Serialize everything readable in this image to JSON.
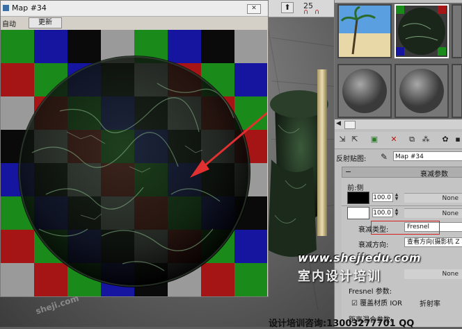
{
  "viewport": {
    "toolbar_numbers": [
      "25"
    ]
  },
  "map_window": {
    "title": "Map #34",
    "close_glyph": "✕",
    "auto_label": "自动",
    "update_label": "更新",
    "checker_colors": [
      [
        "#1a8a1a",
        "#1515a0",
        "#0a0a0a",
        "#9a9a9a",
        "#1a8a1a",
        "#1515a0",
        "#0a0a0a",
        "#9a9a9a"
      ],
      [
        "#a51515",
        "#1a8a1a",
        "#1515a0",
        "#0a0a0a",
        "#9a9a9a",
        "#a51515",
        "#1a8a1a",
        "#1515a0"
      ],
      [
        "#9a9a9a",
        "#a51515",
        "#1a8a1a",
        "#1515a0",
        "#0a0a0a",
        "#9a9a9a",
        "#a51515",
        "#1a8a1a"
      ],
      [
        "#0a0a0a",
        "#9a9a9a",
        "#a51515",
        "#1a8a1a",
        "#1515a0",
        "#0a0a0a",
        "#9a9a9a",
        "#a51515"
      ],
      [
        "#1515a0",
        "#0a0a0a",
        "#9a9a9a",
        "#a51515",
        "#1a8a1a",
        "#1515a0",
        "#0a0a0a",
        "#9a9a9a"
      ],
      [
        "#1a8a1a",
        "#1515a0",
        "#0a0a0a",
        "#9a9a9a",
        "#a51515",
        "#1a8a1a",
        "#1515a0",
        "#0a0a0a"
      ],
      [
        "#a51515",
        "#1a8a1a",
        "#1515a0",
        "#0a0a0a",
        "#9a9a9a",
        "#a51515",
        "#1a8a1a",
        "#1515a0"
      ],
      [
        "#9a9a9a",
        "#a51515",
        "#1a8a1a",
        "#1515a0",
        "#0a0a0a",
        "#9a9a9a",
        "#a51515",
        "#1a8a1a"
      ]
    ]
  },
  "side_panel": {
    "map_label": "反射贴图:",
    "map_name": "Map #34",
    "rollout_title": "衰减参数",
    "front_side_label": "前:侧",
    "front_value": "100.0",
    "side_value": "100.0",
    "none_label": "None",
    "falloff_type_label": "衰减类型:",
    "falloff_type_value": "Fresnel",
    "falloff_dir_label": "衰减方向:",
    "falloff_dir_value": "查看方向(摄影机 Z 轴)",
    "fresnel_params_label": "Fresnel 参数:",
    "override_ior_label": "覆盖材质 IOR",
    "ior_label": "折射率",
    "distance_blend_label": "距离混合参数:",
    "front_color": "#000000",
    "side_color": "#ffffff",
    "highlight_color": "#d51f1f"
  },
  "watermark": {
    "url": "www.shejiedu.com",
    "cn": "室内设计培训",
    "bottom": "设计培训咨询:13003277701 QQ",
    "left": "sheji.com"
  }
}
